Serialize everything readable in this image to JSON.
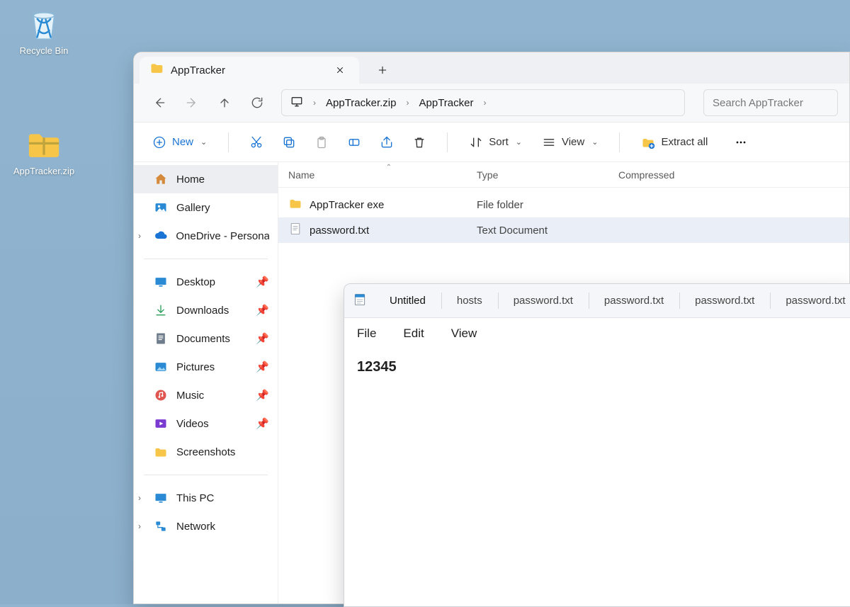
{
  "desktop": {
    "recycle_bin": "Recycle Bin",
    "apptracker_zip": "AppTracker.zip"
  },
  "explorer": {
    "tab": {
      "title": "AppTracker"
    },
    "breadcrumb": {
      "seg1": "AppTracker.zip",
      "seg2": "AppTracker"
    },
    "search_placeholder": "Search AppTracker",
    "toolbar": {
      "new": "New",
      "sort": "Sort",
      "view": "View",
      "extract": "Extract all"
    },
    "columns": {
      "name": "Name",
      "type": "Type",
      "compressed": "Compressed"
    },
    "rows": [
      {
        "name": "AppTracker exe",
        "type": "File folder",
        "kind": "folder",
        "selected": false
      },
      {
        "name": "password.txt",
        "type": "Text Document",
        "kind": "txt",
        "selected": true
      }
    ],
    "sidebar": {
      "home": "Home",
      "gallery": "Gallery",
      "onedrive": "OneDrive - Personal",
      "desktop": "Desktop",
      "downloads": "Downloads",
      "documents": "Documents",
      "pictures": "Pictures",
      "music": "Music",
      "videos": "Videos",
      "screenshots": "Screenshots",
      "thispc": "This PC",
      "network": "Network"
    }
  },
  "notepad": {
    "tabs": [
      "Untitled",
      "hosts",
      "password.txt",
      "password.txt",
      "password.txt",
      "password.txt"
    ],
    "menus": {
      "file": "File",
      "edit": "Edit",
      "view": "View"
    },
    "content": "12345"
  }
}
